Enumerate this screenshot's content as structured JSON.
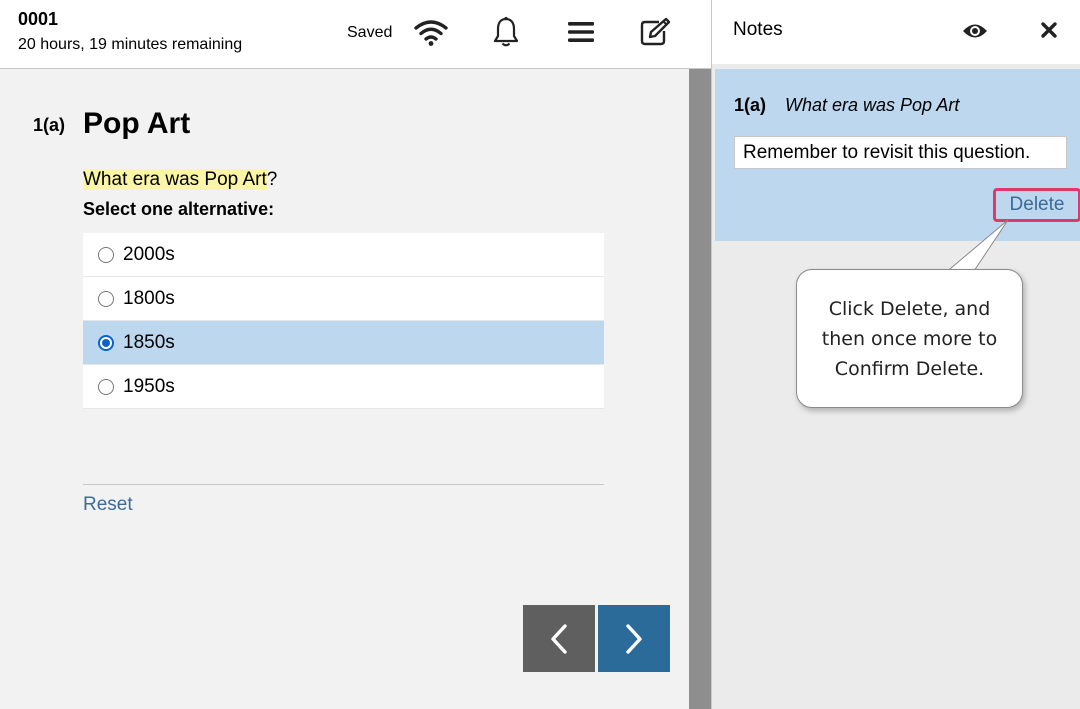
{
  "header": {
    "exam_id": "0001",
    "time_remaining": "20 hours, 19 minutes remaining",
    "status": "Saved",
    "icons": [
      "wifi-icon",
      "bell-icon",
      "menu-icon",
      "notes-edit-icon"
    ]
  },
  "question": {
    "number": "1(a)",
    "title": "Pop Art",
    "text_highlighted": "What era was Pop Art",
    "text_suffix": "?",
    "instruction": "Select one alternative:",
    "options": [
      {
        "label": "2000s",
        "selected": false
      },
      {
        "label": "1800s",
        "selected": false
      },
      {
        "label": "1850s",
        "selected": true
      },
      {
        "label": "1950s",
        "selected": false
      }
    ],
    "reset_label": "Reset"
  },
  "navigation": {
    "prev_icon": "chevron-left-icon",
    "next_icon": "chevron-right-icon"
  },
  "notes": {
    "title": "Notes",
    "note": {
      "number": "1(a)",
      "question": "What era was Pop Art",
      "value": "Remember to revisit this question.",
      "delete_label": "Delete"
    }
  },
  "callout": {
    "text": "Click Delete, and then once more to Confirm Delete."
  },
  "colors": {
    "highlight": "#fbf5a8",
    "selected_option": "#bdd7ef",
    "link": "#3b6b96",
    "next_button": "#2b6b9a",
    "prev_button": "#5f5f5f",
    "delete_outline": "#e0386b"
  }
}
